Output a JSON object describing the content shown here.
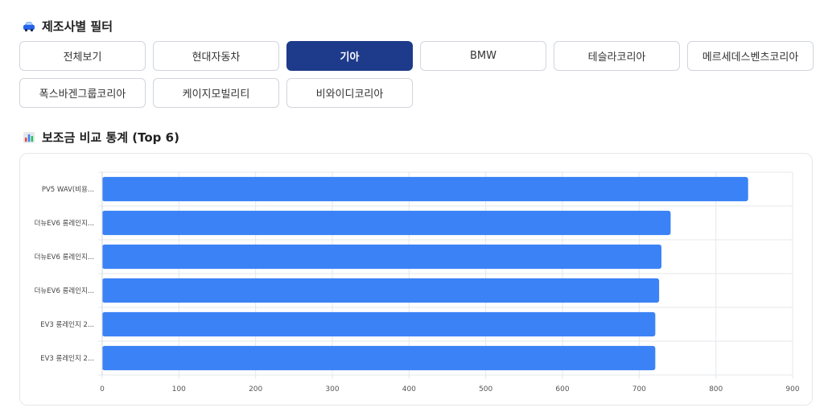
{
  "filter": {
    "title": "제조사별 필터",
    "icon": "car-icon",
    "buttons": [
      {
        "label": "전체보기",
        "active": false
      },
      {
        "label": "현대자동차",
        "active": false
      },
      {
        "label": "기아",
        "active": true
      },
      {
        "label": "BMW",
        "active": false
      },
      {
        "label": "테슬라코리아",
        "active": false
      },
      {
        "label": "메르세데스벤츠코리아",
        "active": false
      },
      {
        "label": "폭스바겐그룹코리아",
        "active": false
      },
      {
        "label": "케이지모빌리티",
        "active": false
      },
      {
        "label": "비와이디코리아",
        "active": false
      }
    ]
  },
  "stats": {
    "title": "보조금 비교 통계 (Top 6)",
    "icon": "bar-chart-icon"
  },
  "colors": {
    "accent": "#1e3a8a",
    "bar": "#3b82f6"
  },
  "chart_data": {
    "type": "bar",
    "orientation": "horizontal",
    "categories": [
      "PV5 WAV(비용...",
      "더뉴EV6 롱레인지...",
      "더뉴EV6 롱레인지...",
      "더뉴EV6 롱레인지...",
      "EV3 롱레인지 2...",
      "EV3 롱레인지 2..."
    ],
    "values": [
      842,
      741,
      729,
      726,
      721,
      721
    ],
    "xlim": [
      0,
      900
    ],
    "xticks": [
      "0",
      "100",
      "200",
      "300",
      "400",
      "500",
      "600",
      "700",
      "800",
      "900"
    ],
    "grid": true,
    "legend": "none"
  }
}
